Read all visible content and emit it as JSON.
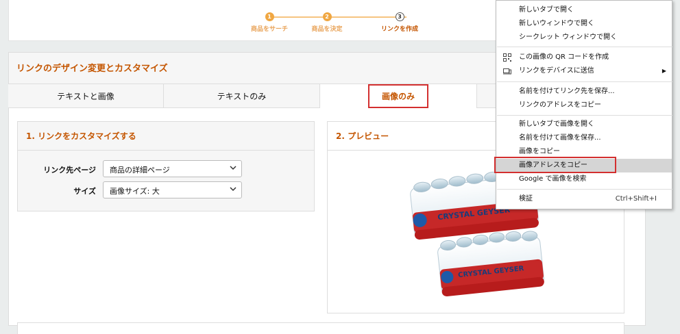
{
  "stepper": {
    "steps": [
      {
        "num": "1",
        "label": "商品をサーチ"
      },
      {
        "num": "2",
        "label": "商品を決定"
      },
      {
        "num": "3",
        "label": "リンクを作成"
      }
    ]
  },
  "main": {
    "title": "リンクのデザイン変更とカスタマイズ",
    "tabs": [
      "テキストと画像",
      "テキストのみ",
      "画像のみ"
    ]
  },
  "customize": {
    "title": "1. リンクをカスタマイズする",
    "link_dest_label": "リンク先ページ",
    "link_dest_value": "商品の詳細ページ",
    "size_label": "サイズ",
    "size_value": "画像サイズ: 大"
  },
  "preview": {
    "title": "2. プレビュー",
    "product_brand": "CRYSTAL GEYSER"
  },
  "context_menu": {
    "items": [
      {
        "label": "新しいタブで開く"
      },
      {
        "label": "新しいウィンドウで開く"
      },
      {
        "label": "シークレット ウィンドウで開く"
      },
      {
        "label": "この画像の QR コードを作成",
        "icon": "qr-code-icon"
      },
      {
        "label": "リンクをデバイスに送信",
        "icon": "device-icon",
        "submenu": true
      },
      {
        "label": "名前を付けてリンク先を保存..."
      },
      {
        "label": "リンクのアドレスをコピー"
      },
      {
        "label": "新しいタブで画像を開く"
      },
      {
        "label": "名前を付けて画像を保存..."
      },
      {
        "label": "画像をコピー"
      },
      {
        "label": "画像アドレスをコピー",
        "highlighted": true
      },
      {
        "label": "Google で画像を検索"
      },
      {
        "label": "検証",
        "shortcut": "Ctrl+Shift+I"
      }
    ]
  },
  "colors": {
    "accent": "#c45500",
    "step_active": "#f0a742",
    "highlight_border": "#d32f2f",
    "bottle_red": "#c62828"
  }
}
